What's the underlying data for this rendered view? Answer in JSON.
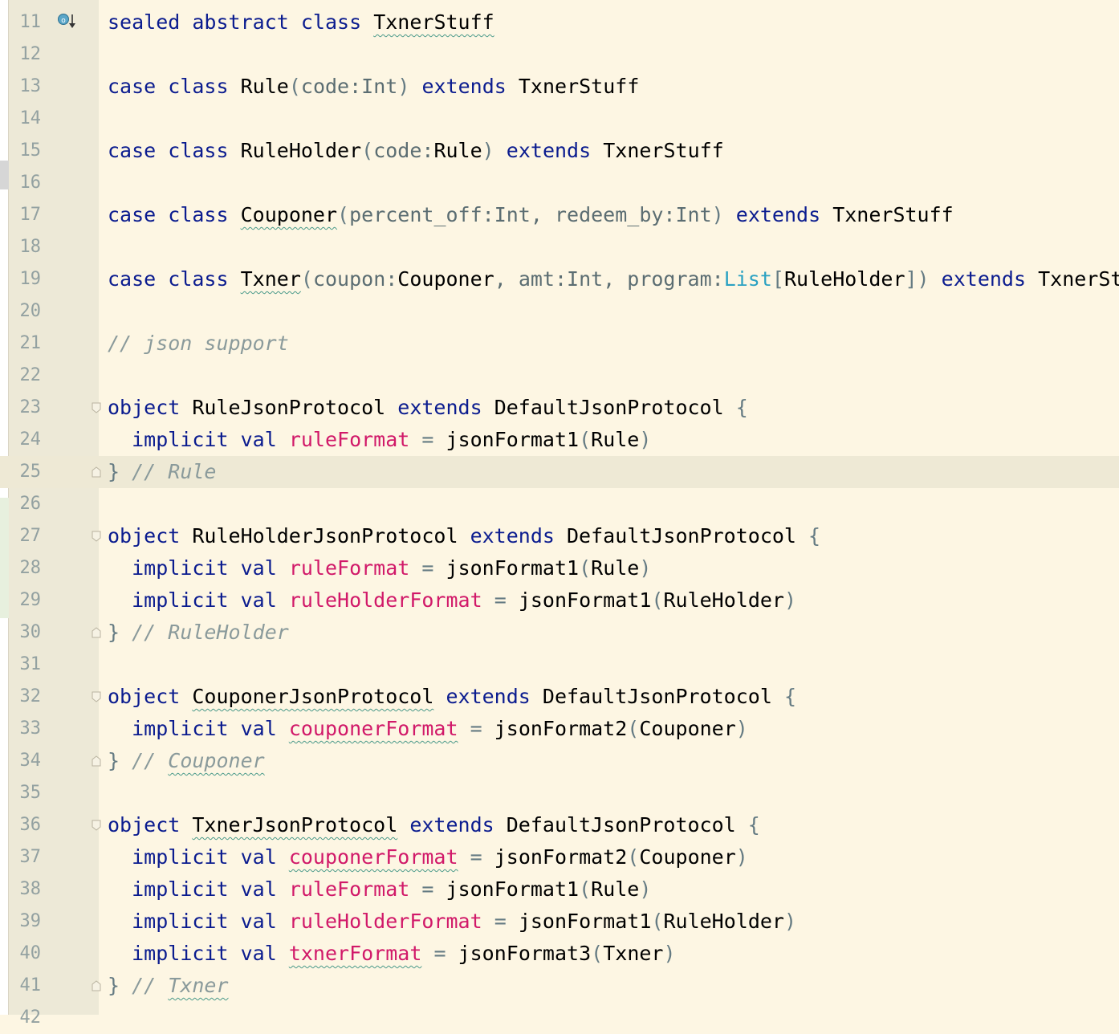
{
  "editor": {
    "lines": [
      {
        "n": "11",
        "tokens": [
          [
            "kw",
            "sealed"
          ],
          [
            "",
            " "
          ],
          [
            "kw",
            "abstract"
          ],
          [
            "",
            " "
          ],
          [
            "kw",
            "class"
          ],
          [
            "",
            " "
          ],
          [
            "cls wavy",
            "TxnerStuff"
          ]
        ],
        "icon": true
      },
      {
        "n": "12",
        "tokens": []
      },
      {
        "n": "13",
        "tokens": [
          [
            "kw",
            "case"
          ],
          [
            "",
            " "
          ],
          [
            "kw",
            "class"
          ],
          [
            "",
            " "
          ],
          [
            "cls",
            "Rule"
          ],
          [
            "punc",
            "("
          ],
          [
            "param",
            "code:Int"
          ],
          [
            "punc",
            ")"
          ],
          [
            "",
            " "
          ],
          [
            "kw",
            "extends"
          ],
          [
            "",
            " "
          ],
          [
            "cls",
            "TxnerStuff"
          ]
        ]
      },
      {
        "n": "14",
        "tokens": []
      },
      {
        "n": "15",
        "tokens": [
          [
            "kw",
            "case"
          ],
          [
            "",
            " "
          ],
          [
            "kw",
            "class"
          ],
          [
            "",
            " "
          ],
          [
            "cls",
            "RuleHolder"
          ],
          [
            "punc",
            "("
          ],
          [
            "param",
            "code:"
          ],
          [
            "cls",
            "Rule"
          ],
          [
            "punc",
            ")"
          ],
          [
            "",
            " "
          ],
          [
            "kw",
            "extends"
          ],
          [
            "",
            " "
          ],
          [
            "cls",
            "TxnerStuff"
          ]
        ]
      },
      {
        "n": "16",
        "tokens": []
      },
      {
        "n": "17",
        "tokens": [
          [
            "kw",
            "case"
          ],
          [
            "",
            " "
          ],
          [
            "kw",
            "class"
          ],
          [
            "",
            " "
          ],
          [
            "cls wavy",
            "Couponer"
          ],
          [
            "punc",
            "("
          ],
          [
            "param",
            "percent_off:Int, redeem_by:Int"
          ],
          [
            "punc",
            ")"
          ],
          [
            "",
            " "
          ],
          [
            "kw",
            "extends"
          ],
          [
            "",
            " "
          ],
          [
            "cls",
            "TxnerStuff"
          ]
        ]
      },
      {
        "n": "18",
        "tokens": []
      },
      {
        "n": "19",
        "tokens": [
          [
            "kw",
            "case"
          ],
          [
            "",
            " "
          ],
          [
            "kw",
            "class"
          ],
          [
            "",
            " "
          ],
          [
            "cls wavy",
            "Txner"
          ],
          [
            "punc",
            "("
          ],
          [
            "param",
            "coupon:"
          ],
          [
            "cls",
            "Couponer"
          ],
          [
            "param",
            ", amt:Int, program:"
          ],
          [
            "ty",
            "List"
          ],
          [
            "punc",
            "["
          ],
          [
            "cls",
            "RuleHolder"
          ],
          [
            "punc",
            "])"
          ],
          [
            "",
            " "
          ],
          [
            "kw",
            "extends"
          ],
          [
            "",
            " "
          ],
          [
            "cls",
            "TxnerStuff"
          ]
        ]
      },
      {
        "n": "20",
        "tokens": []
      },
      {
        "n": "21",
        "tokens": [
          [
            "cmt",
            "// json support"
          ]
        ]
      },
      {
        "n": "22",
        "tokens": []
      },
      {
        "n": "23",
        "tokens": [
          [
            "kw",
            "object"
          ],
          [
            "",
            " "
          ],
          [
            "cls",
            "RuleJsonProtocol"
          ],
          [
            "",
            " "
          ],
          [
            "kw",
            "extends"
          ],
          [
            "",
            " "
          ],
          [
            "cls",
            "DefaultJsonProtocol"
          ],
          [
            "",
            " "
          ],
          [
            "punc",
            "{"
          ]
        ],
        "fold": "open"
      },
      {
        "n": "24",
        "tokens": [
          [
            "",
            "  "
          ],
          [
            "kw",
            "implicit"
          ],
          [
            "",
            " "
          ],
          [
            "kw",
            "val"
          ],
          [
            "",
            " "
          ],
          [
            "fld",
            "ruleFormat"
          ],
          [
            "",
            " "
          ],
          [
            "punc",
            "="
          ],
          [
            "",
            " "
          ],
          [
            "cls",
            "jsonFormat1"
          ],
          [
            "punc",
            "("
          ],
          [
            "cls",
            "Rule"
          ],
          [
            "punc",
            ")"
          ]
        ]
      },
      {
        "n": "25",
        "tokens": [
          [
            "punc",
            "}"
          ],
          [
            "",
            " "
          ],
          [
            "cmt",
            "// Rule"
          ]
        ],
        "fold": "close",
        "current": true
      },
      {
        "n": "26",
        "tokens": []
      },
      {
        "n": "27",
        "tokens": [
          [
            "kw",
            "object"
          ],
          [
            "",
            " "
          ],
          [
            "cls",
            "RuleHolderJsonProtocol"
          ],
          [
            "",
            " "
          ],
          [
            "kw",
            "extends"
          ],
          [
            "",
            " "
          ],
          [
            "cls",
            "DefaultJsonProtocol"
          ],
          [
            "",
            " "
          ],
          [
            "punc",
            "{"
          ]
        ],
        "fold": "open"
      },
      {
        "n": "28",
        "tokens": [
          [
            "",
            "  "
          ],
          [
            "kw",
            "implicit"
          ],
          [
            "",
            " "
          ],
          [
            "kw",
            "val"
          ],
          [
            "",
            " "
          ],
          [
            "fld",
            "ruleFormat"
          ],
          [
            "",
            " "
          ],
          [
            "punc",
            "="
          ],
          [
            "",
            " "
          ],
          [
            "cls",
            "jsonFormat1"
          ],
          [
            "punc",
            "("
          ],
          [
            "cls",
            "Rule"
          ],
          [
            "punc",
            ")"
          ]
        ]
      },
      {
        "n": "29",
        "tokens": [
          [
            "",
            "  "
          ],
          [
            "kw",
            "implicit"
          ],
          [
            "",
            " "
          ],
          [
            "kw",
            "val"
          ],
          [
            "",
            " "
          ],
          [
            "fld",
            "ruleHolderFormat"
          ],
          [
            "",
            " "
          ],
          [
            "punc",
            "="
          ],
          [
            "",
            " "
          ],
          [
            "cls",
            "jsonFormat1"
          ],
          [
            "punc",
            "("
          ],
          [
            "cls",
            "RuleHolder"
          ],
          [
            "punc",
            ")"
          ]
        ]
      },
      {
        "n": "30",
        "tokens": [
          [
            "punc",
            "}"
          ],
          [
            "",
            " "
          ],
          [
            "cmt",
            "// RuleHolder"
          ]
        ],
        "fold": "close"
      },
      {
        "n": "31",
        "tokens": []
      },
      {
        "n": "32",
        "tokens": [
          [
            "kw",
            "object"
          ],
          [
            "",
            " "
          ],
          [
            "cls wavy",
            "CouponerJsonProtocol"
          ],
          [
            "",
            " "
          ],
          [
            "kw",
            "extends"
          ],
          [
            "",
            " "
          ],
          [
            "cls",
            "DefaultJsonProtocol"
          ],
          [
            "",
            " "
          ],
          [
            "punc",
            "{"
          ]
        ],
        "fold": "open"
      },
      {
        "n": "33",
        "tokens": [
          [
            "",
            "  "
          ],
          [
            "kw",
            "implicit"
          ],
          [
            "",
            " "
          ],
          [
            "kw",
            "val"
          ],
          [
            "",
            " "
          ],
          [
            "fld wavy",
            "couponerFormat"
          ],
          [
            "",
            " "
          ],
          [
            "punc",
            "="
          ],
          [
            "",
            " "
          ],
          [
            "cls",
            "jsonFormat2"
          ],
          [
            "punc",
            "("
          ],
          [
            "cls",
            "Couponer"
          ],
          [
            "punc",
            ")"
          ]
        ]
      },
      {
        "n": "34",
        "tokens": [
          [
            "punc",
            "}"
          ],
          [
            "",
            " "
          ],
          [
            "cmt",
            "// "
          ],
          [
            "cmt wavy",
            "Couponer"
          ]
        ],
        "fold": "close"
      },
      {
        "n": "35",
        "tokens": []
      },
      {
        "n": "36",
        "tokens": [
          [
            "kw",
            "object"
          ],
          [
            "",
            " "
          ],
          [
            "cls wavy",
            "TxnerJsonProtocol"
          ],
          [
            "",
            " "
          ],
          [
            "kw",
            "extends"
          ],
          [
            "",
            " "
          ],
          [
            "cls",
            "DefaultJsonProtocol"
          ],
          [
            "",
            " "
          ],
          [
            "punc",
            "{"
          ]
        ],
        "fold": "open"
      },
      {
        "n": "37",
        "tokens": [
          [
            "",
            "  "
          ],
          [
            "kw",
            "implicit"
          ],
          [
            "",
            " "
          ],
          [
            "kw",
            "val"
          ],
          [
            "",
            " "
          ],
          [
            "fld wavy",
            "couponerFormat"
          ],
          [
            "",
            " "
          ],
          [
            "punc",
            "="
          ],
          [
            "",
            " "
          ],
          [
            "cls",
            "jsonFormat2"
          ],
          [
            "punc",
            "("
          ],
          [
            "cls",
            "Couponer"
          ],
          [
            "punc",
            ")"
          ]
        ]
      },
      {
        "n": "38",
        "tokens": [
          [
            "",
            "  "
          ],
          [
            "kw",
            "implicit"
          ],
          [
            "",
            " "
          ],
          [
            "kw",
            "val"
          ],
          [
            "",
            " "
          ],
          [
            "fld",
            "ruleFormat"
          ],
          [
            "",
            " "
          ],
          [
            "punc",
            "="
          ],
          [
            "",
            " "
          ],
          [
            "cls",
            "jsonFormat1"
          ],
          [
            "punc",
            "("
          ],
          [
            "cls",
            "Rule"
          ],
          [
            "punc",
            ")"
          ]
        ]
      },
      {
        "n": "39",
        "tokens": [
          [
            "",
            "  "
          ],
          [
            "kw",
            "implicit"
          ],
          [
            "",
            " "
          ],
          [
            "kw",
            "val"
          ],
          [
            "",
            " "
          ],
          [
            "fld",
            "ruleHolderFormat"
          ],
          [
            "",
            " "
          ],
          [
            "punc",
            "="
          ],
          [
            "",
            " "
          ],
          [
            "cls",
            "jsonFormat1"
          ],
          [
            "punc",
            "("
          ],
          [
            "cls",
            "RuleHolder"
          ],
          [
            "punc",
            ")"
          ]
        ]
      },
      {
        "n": "40",
        "tokens": [
          [
            "",
            "  "
          ],
          [
            "kw",
            "implicit"
          ],
          [
            "",
            " "
          ],
          [
            "kw",
            "val"
          ],
          [
            "",
            " "
          ],
          [
            "fld wavy",
            "txnerFormat"
          ],
          [
            "",
            " "
          ],
          [
            "punc",
            "="
          ],
          [
            "",
            " "
          ],
          [
            "cls",
            "jsonFormat3"
          ],
          [
            "punc",
            "("
          ],
          [
            "cls",
            "Txner"
          ],
          [
            "punc",
            ")"
          ]
        ]
      },
      {
        "n": "41",
        "tokens": [
          [
            "punc",
            "}"
          ],
          [
            "",
            " "
          ],
          [
            "cmt",
            "// "
          ],
          [
            "cmt wavy",
            "Txner"
          ]
        ],
        "fold": "close"
      },
      {
        "n": "42",
        "tokens": []
      }
    ],
    "gutter_icon": "override-method-icon",
    "colors": {
      "background": "#fdf6e3",
      "gutter": "#ede9d7",
      "keyword": "#0b1c8f",
      "field": "#d11969",
      "comment": "#8a9a9b",
      "type": "#2aa1c2"
    }
  }
}
